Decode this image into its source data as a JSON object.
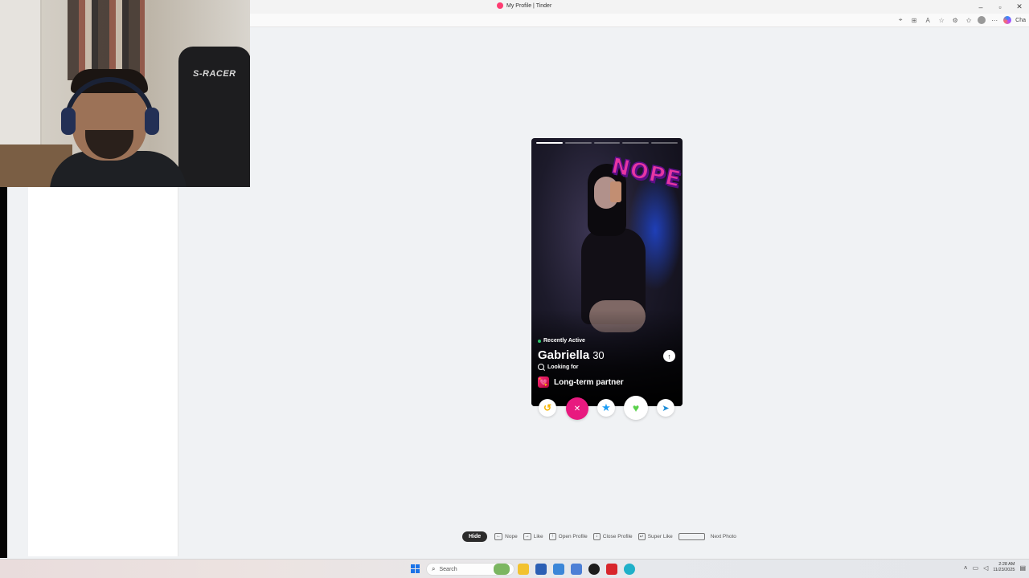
{
  "browser": {
    "tab_title": "My Profile | Tinder",
    "window_controls": [
      "–",
      "▫",
      "✕"
    ],
    "toolbar_icons": [
      "location-icon",
      "apps-icon",
      "read-aloud-icon",
      "favorite-icon",
      "extensions-icon",
      "collections-icon",
      "profile-icon",
      "more-icon",
      "copilot-icon"
    ],
    "toolbar_text": "Cha"
  },
  "webcam": {
    "chair_brand": "S-RACER"
  },
  "card": {
    "photo_count": 5,
    "active_photo": 1,
    "stamp": "NOPE",
    "status": "Recently Active",
    "name": "Gabriella",
    "age": "30",
    "looking_for_label": "Looking for",
    "relationship_goal": "Long-term partner",
    "info_icon": "↑",
    "goal_emoji": "💘"
  },
  "actions": {
    "rewind": "↺",
    "nope": "✕",
    "super_like": "★",
    "like": "♥",
    "boost": "➤"
  },
  "shortcuts": {
    "hide": "Hide",
    "nope": "Nope",
    "like": "Like",
    "open_profile": "Open Profile",
    "close_profile": "Close Profile",
    "super_like": "Super Like",
    "next_photo": "Next Photo",
    "keys": {
      "nope": "←",
      "like": "→",
      "open_profile": "↑",
      "close_profile": "↓",
      "super_like": "↵"
    }
  },
  "taskbar": {
    "search_placeholder": "Search",
    "time": "2:28 AM",
    "date": "11/23/2025"
  },
  "colors": {
    "brand_pink": "#e8197f",
    "super_like_blue": "#1b9df5",
    "like_green": "#5ad14b",
    "rewind_yellow": "#f7b500"
  }
}
